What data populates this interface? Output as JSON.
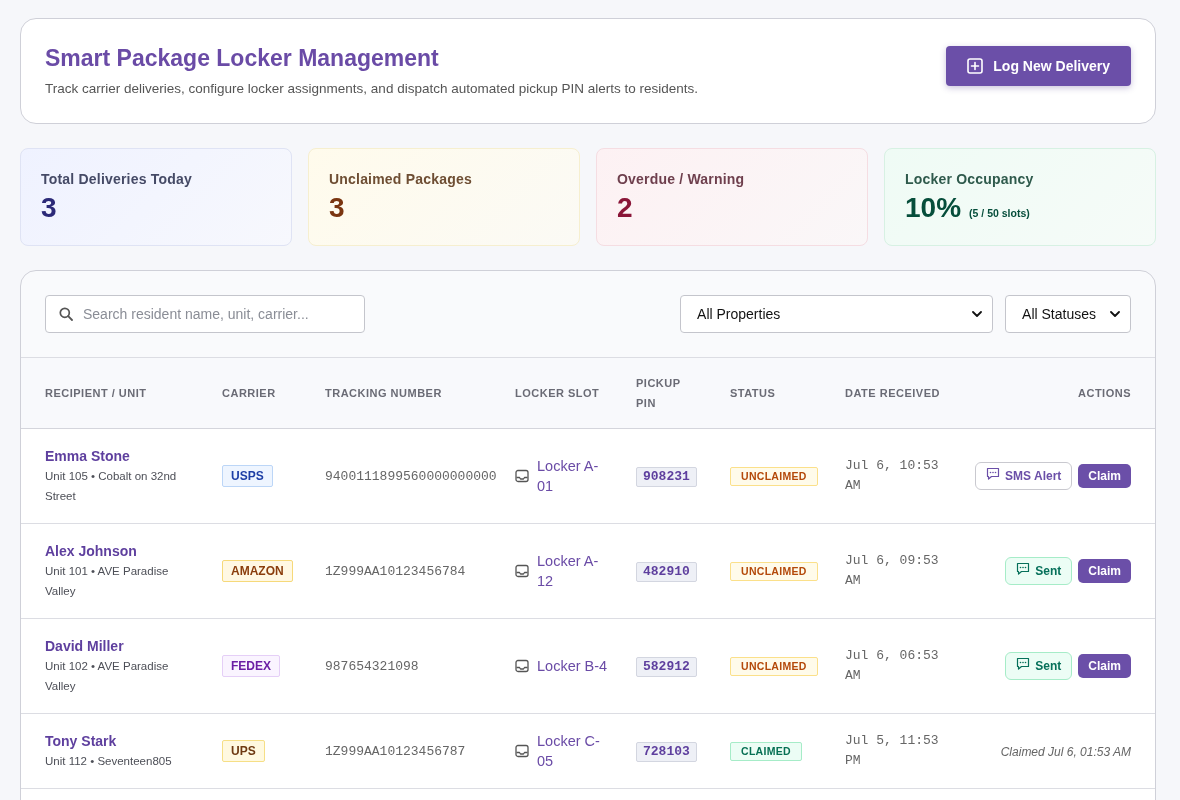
{
  "header": {
    "title": "Smart Package Locker Management",
    "subtitle": "Track carrier deliveries, configure locker assignments, and dispatch automated pickup PIN alerts to residents.",
    "primary_button": "Log New Delivery"
  },
  "stats": [
    {
      "kind": "info",
      "label": "Total Deliveries Today",
      "value": "3"
    },
    {
      "kind": "warning",
      "label": "Unclaimed Packages",
      "value": "3"
    },
    {
      "kind": "danger",
      "label": "Overdue / Warning",
      "value": "2"
    },
    {
      "kind": "success",
      "label": "Locker Occupancy",
      "value": "10%",
      "note": "(5 / 50 slots)"
    }
  ],
  "toolbar": {
    "search": {
      "placeholder": "Search resident name, unit, carrier..."
    },
    "filters": [
      {
        "label": "All Properties"
      },
      {
        "label": "All Statuses"
      }
    ]
  },
  "table": {
    "columns": [
      "RECIPIENT / UNIT",
      "CARRIER",
      "TRACKING NUMBER",
      "LOCKER SLOT",
      "PICKUP PIN",
      "STATUS",
      "DATE RECEIVED",
      "ACTIONS"
    ],
    "rows": [
      {
        "name": "Emma Stone",
        "unit": "Unit 105 • Cobalt on 32nd Street",
        "carrier": {
          "kind": "usps",
          "label": "USPS"
        },
        "tracking": "9400111899560000000000",
        "locker": "Locker A-01",
        "pin": "908231",
        "status": {
          "kind": "unclaimed",
          "label": "UNCLAIMED"
        },
        "date": "Jul 6, 10:53 AM",
        "actions": {
          "kind": "pending",
          "sms": {
            "label": "SMS Alert",
            "sent": false
          },
          "claim": "Claim"
        }
      },
      {
        "name": "Alex Johnson",
        "unit": "Unit 101 • AVE Paradise Valley",
        "carrier": {
          "kind": "amazon",
          "label": "AMAZON"
        },
        "tracking": "1Z999AA10123456784",
        "locker": "Locker A-12",
        "pin": "482910",
        "status": {
          "kind": "unclaimed",
          "label": "UNCLAIMED"
        },
        "date": "Jul 6, 09:53 AM",
        "actions": {
          "kind": "pending",
          "sms": {
            "label": "Sent",
            "sent": true
          },
          "claim": "Claim"
        }
      },
      {
        "name": "David Miller",
        "unit": "Unit 102 • AVE Paradise Valley",
        "carrier": {
          "kind": "fedex",
          "label": "FEDEX"
        },
        "tracking": "987654321098",
        "locker": "Locker B-4",
        "pin": "582912",
        "status": {
          "kind": "unclaimed",
          "label": "UNCLAIMED"
        },
        "date": "Jul 6, 06:53 AM",
        "actions": {
          "kind": "pending",
          "sms": {
            "label": "Sent",
            "sent": true
          },
          "claim": "Claim"
        }
      },
      {
        "name": "Tony Stark",
        "unit": "Unit 112 • Seventeen805",
        "carrier": {
          "kind": "ups",
          "label": "UPS"
        },
        "tracking": "1Z999AA10123456787",
        "locker": "Locker C-05",
        "pin": "728103",
        "status": {
          "kind": "claimed",
          "label": "CLAIMED"
        },
        "date": "Jul 5, 11:53 PM",
        "actions": {
          "kind": "claimed",
          "note": "Claimed Jul 6, 01:53 AM"
        }
      }
    ]
  }
}
